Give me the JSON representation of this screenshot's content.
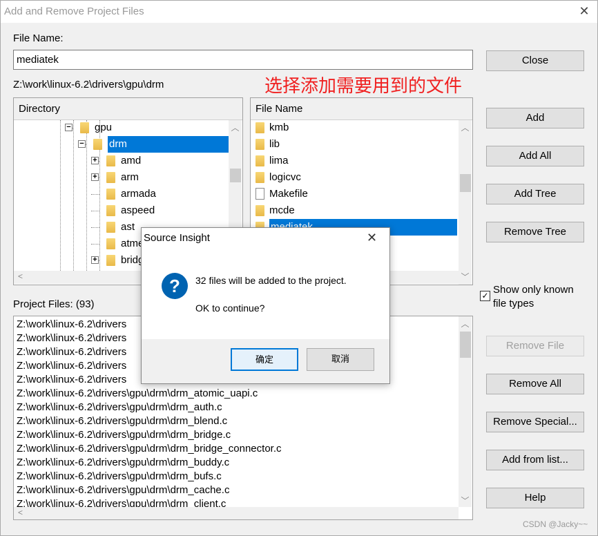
{
  "window": {
    "title": "Add and Remove Project Files",
    "close_glyph": "✕"
  },
  "file_name": {
    "label": "File Name:",
    "value": "mediatek"
  },
  "current_path": "Z:\\work\\linux-6.2\\drivers\\gpu\\drm",
  "annotation": "选择添加需要用到的文件",
  "directory": {
    "header": "Directory",
    "items": [
      {
        "label": "gpu",
        "expander": "minus"
      },
      {
        "label": "drm",
        "expander": "minus",
        "selected": true
      },
      {
        "label": "amd",
        "expander": "plus"
      },
      {
        "label": "arm",
        "expander": "plus"
      },
      {
        "label": "armada",
        "expander": ""
      },
      {
        "label": "aspeed",
        "expander": ""
      },
      {
        "label": "ast",
        "expander": ""
      },
      {
        "label": "atmel",
        "expander": ""
      },
      {
        "label": "bridge",
        "expander": "plus"
      }
    ]
  },
  "files": {
    "header": "File Name",
    "items": [
      {
        "label": "kmb",
        "icon": "folder"
      },
      {
        "label": "lib",
        "icon": "folder"
      },
      {
        "label": "lima",
        "icon": "folder"
      },
      {
        "label": "logicvc",
        "icon": "folder"
      },
      {
        "label": "Makefile",
        "icon": "file"
      },
      {
        "label": "mcde",
        "icon": "folder"
      },
      {
        "label": "mediatek",
        "icon": "folder",
        "selected": true
      }
    ]
  },
  "buttons": {
    "close": "Close",
    "add": "Add",
    "add_all": "Add All",
    "add_tree": "Add Tree",
    "remove_tree": "Remove Tree",
    "remove_file": "Remove File",
    "remove_all": "Remove All",
    "remove_special": "Remove Special...",
    "add_from_list": "Add from list...",
    "help": "Help"
  },
  "show_known": {
    "label_1": "Show only known",
    "label_2": "file types",
    "checked": true,
    "glyph": "✓"
  },
  "project_files": {
    "label": "Project Files: (93)",
    "items": [
      "Z:\\work\\linux-6.2\\drivers",
      "Z:\\work\\linux-6.2\\drivers",
      "Z:\\work\\linux-6.2\\drivers",
      "Z:\\work\\linux-6.2\\drivers",
      "Z:\\work\\linux-6.2\\drivers",
      "Z:\\work\\linux-6.2\\drivers\\gpu\\drm\\drm_atomic_uapi.c",
      "Z:\\work\\linux-6.2\\drivers\\gpu\\drm\\drm_auth.c",
      "Z:\\work\\linux-6.2\\drivers\\gpu\\drm\\drm_blend.c",
      "Z:\\work\\linux-6.2\\drivers\\gpu\\drm\\drm_bridge.c",
      "Z:\\work\\linux-6.2\\drivers\\gpu\\drm\\drm_bridge_connector.c",
      "Z:\\work\\linux-6.2\\drivers\\gpu\\drm\\drm_buddy.c",
      "Z:\\work\\linux-6.2\\drivers\\gpu\\drm\\drm_bufs.c",
      "Z:\\work\\linux-6.2\\drivers\\gpu\\drm\\drm_cache.c",
      "Z:\\work\\linux-6.2\\drivers\\gpu\\drm\\drm_client.c"
    ]
  },
  "modal": {
    "title": "Source Insight",
    "close_glyph": "✕",
    "icon": "question-icon",
    "icon_glyph": "?",
    "message": "32 files will be added to the project.",
    "question": "OK to continue?",
    "ok": "确定",
    "cancel": "取消"
  },
  "watermark": "CSDN @Jacky~~",
  "colors": {
    "selection": "#0078d7",
    "annotation": "#f02020",
    "question_icon": "#0063b1"
  }
}
